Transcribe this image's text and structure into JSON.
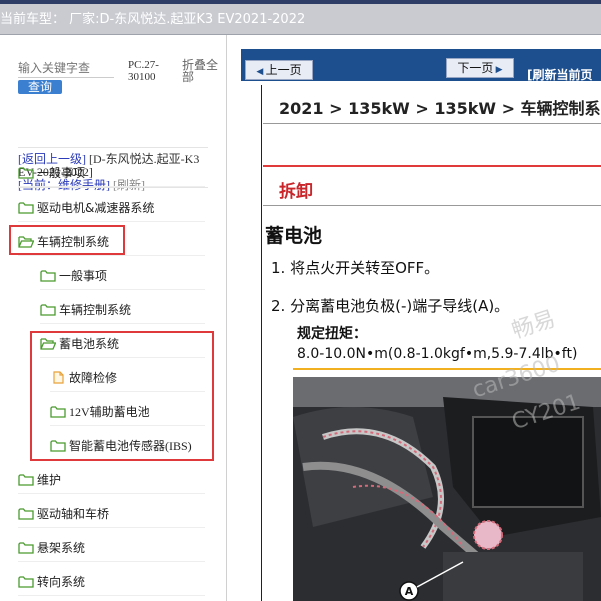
{
  "window": {
    "title": "当前车型：  厂家:D-东风悦达.起亚K3 EV2021-2022"
  },
  "left_pane": {
    "search": {
      "placeholder": "输入关键字查",
      "button": "查询"
    },
    "pc_code": "PC.27-30100",
    "collapse_label": "折叠全部",
    "breadcrumb": {
      "back_link": "[返回上一级]",
      "vehicle": "[D-东风悦达.起亚-K3 EV-2021-2022]",
      "current": "[当前：维修手册]",
      "refresh": "[刷新]"
    },
    "tree": [
      {
        "label": "一般事项",
        "level": 0,
        "icon": "folder-icon"
      },
      {
        "label": "驱动电机&减速器系统",
        "level": 0,
        "icon": "folder-icon"
      },
      {
        "label": "车辆控制系统",
        "level": 0,
        "icon": "folder-open-icon",
        "highlighted": true
      },
      {
        "label": "一般事项",
        "level": 1,
        "icon": "folder-icon"
      },
      {
        "label": "车辆控制系统",
        "level": 1,
        "icon": "folder-icon"
      },
      {
        "label": "蓄电池系统",
        "level": 1,
        "icon": "folder-open-icon",
        "highlighted": true
      },
      {
        "label": "故障检修",
        "level": 2,
        "icon": "document-icon"
      },
      {
        "label": "12V辅助蓄电池",
        "level": 2,
        "icon": "folder-icon"
      },
      {
        "label": "智能蓄电池传感器(IBS)",
        "level": 2,
        "icon": "folder-icon"
      },
      {
        "label": "维护",
        "level": 0,
        "icon": "folder-icon"
      },
      {
        "label": "驱动轴和车桥",
        "level": 0,
        "icon": "folder-icon"
      },
      {
        "label": "悬架系统",
        "level": 0,
        "icon": "folder-icon"
      },
      {
        "label": "转向系统",
        "level": 0,
        "icon": "folder-icon"
      }
    ]
  },
  "right_pane": {
    "nav": {
      "prev": "上一页",
      "next": "下一页",
      "refresh": "[刷新当前页"
    },
    "doc": {
      "breadcrumb": "2021 > 135kW > 135kW > 车辆控制系",
      "section": "拆卸",
      "heading": "蓄电池",
      "steps": [
        {
          "num": "1.",
          "text": "将点火开关转至OFF。"
        },
        {
          "num": "2.",
          "text": "分离蓄电池负极(-)端子导线(A)。"
        }
      ],
      "torque_label": "规定扭矩：",
      "torque_value": "8.0-10.0N•m(0.8-1.0kgf•m,5.9-7.4lb•ft)",
      "figure_callout": "A",
      "watermark": [
        "畅易",
        "car3600",
        "CY201"
      ]
    }
  },
  "colors": {
    "accent_blue": "#1d4f8e",
    "highlight_red": "#e0393b",
    "section_red": "#c8262b",
    "folder_green": "#4a9b2f"
  }
}
